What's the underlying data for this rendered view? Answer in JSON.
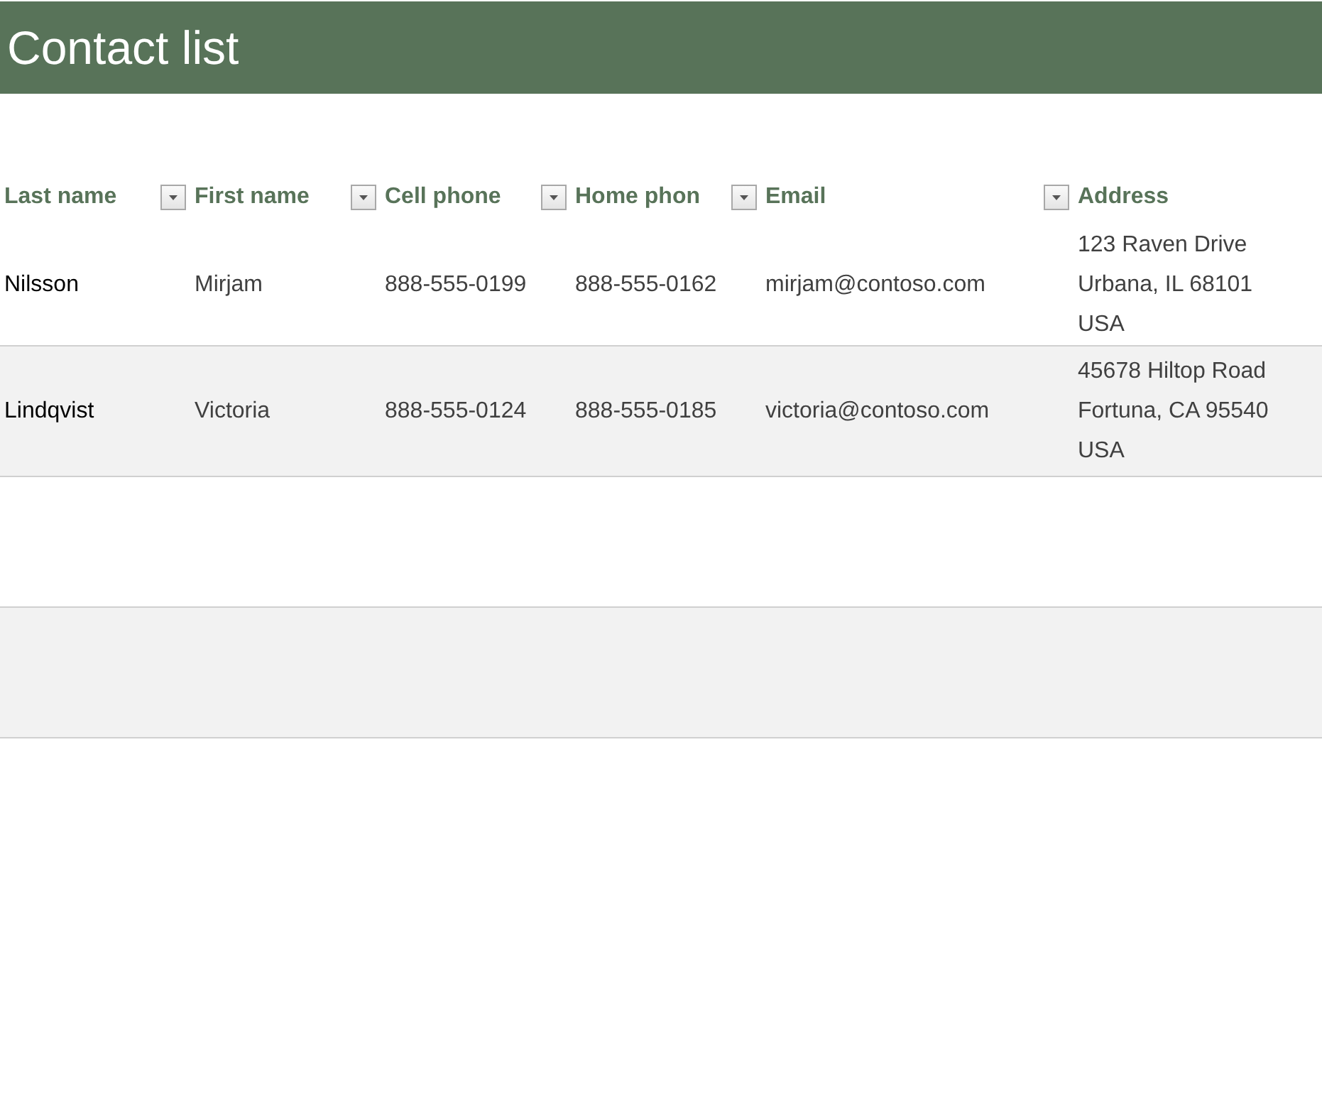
{
  "title": "Contact list",
  "table": {
    "columns": [
      {
        "label": "Last name",
        "filter": true
      },
      {
        "label": "First name",
        "filter": true
      },
      {
        "label": "Cell phone",
        "filter": true
      },
      {
        "label": "Home phon",
        "filter": true
      },
      {
        "label": "Email",
        "filter": true
      },
      {
        "label": "Address",
        "filter": false
      }
    ],
    "rows": [
      {
        "last_name": "Nilsson",
        "first_name": "Mirjam",
        "cell_phone": "888-555-0199",
        "home_phone": "888-555-0162",
        "email": "mirjam@contoso.com",
        "address": [
          "123 Raven Drive",
          "Urbana, IL 68101",
          "USA"
        ]
      },
      {
        "last_name": "Lindqvist",
        "first_name": "Victoria",
        "cell_phone": "888-555-0124",
        "home_phone": "888-555-0185",
        "email": "victoria@contoso.com",
        "address": [
          "45678 Hiltop Road",
          "Fortuna, CA 95540",
          "USA"
        ]
      }
    ]
  }
}
